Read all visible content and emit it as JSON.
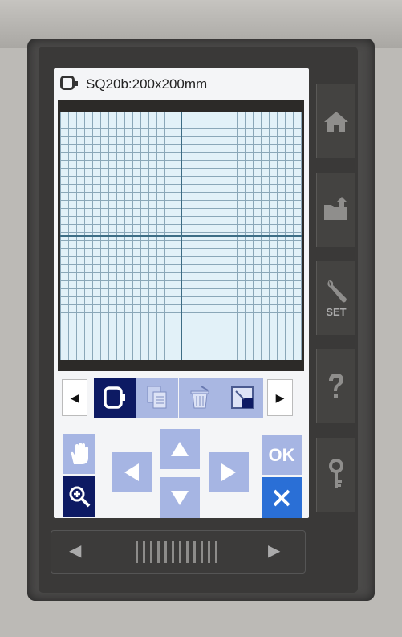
{
  "header": {
    "hoop_icon": "embroidery-hoop-icon",
    "title": "SQ20b:200x200mm"
  },
  "grid": {
    "description_icon": "grid-icon"
  },
  "toolbar": {
    "prev_label": "◀",
    "next_label": "▶",
    "tools": [
      {
        "icon": "hoop-select-icon",
        "state": "selected"
      },
      {
        "icon": "copy-icon",
        "state": "disabled"
      },
      {
        "icon": "delete-icon",
        "state": "disabled"
      },
      {
        "icon": "layout-icon",
        "state": "disabled"
      }
    ]
  },
  "controls": {
    "hand_icon": "hand-pan-icon",
    "zoom_icon": "zoom-in-icon",
    "ok_label": "OK",
    "cancel_icon": "close-icon"
  },
  "side_buttons": {
    "home_icon": "home-icon",
    "folder_icon": "folder-export-icon",
    "set_label": "SET",
    "help_icon": "help-icon",
    "key_icon": "key-icon"
  },
  "scroll": {
    "left_label": "◀",
    "right_label": "▶"
  },
  "colors": {
    "selected": "#0d1a63",
    "inactive": "#a6b5e3",
    "grid": "#e2f1f8"
  }
}
